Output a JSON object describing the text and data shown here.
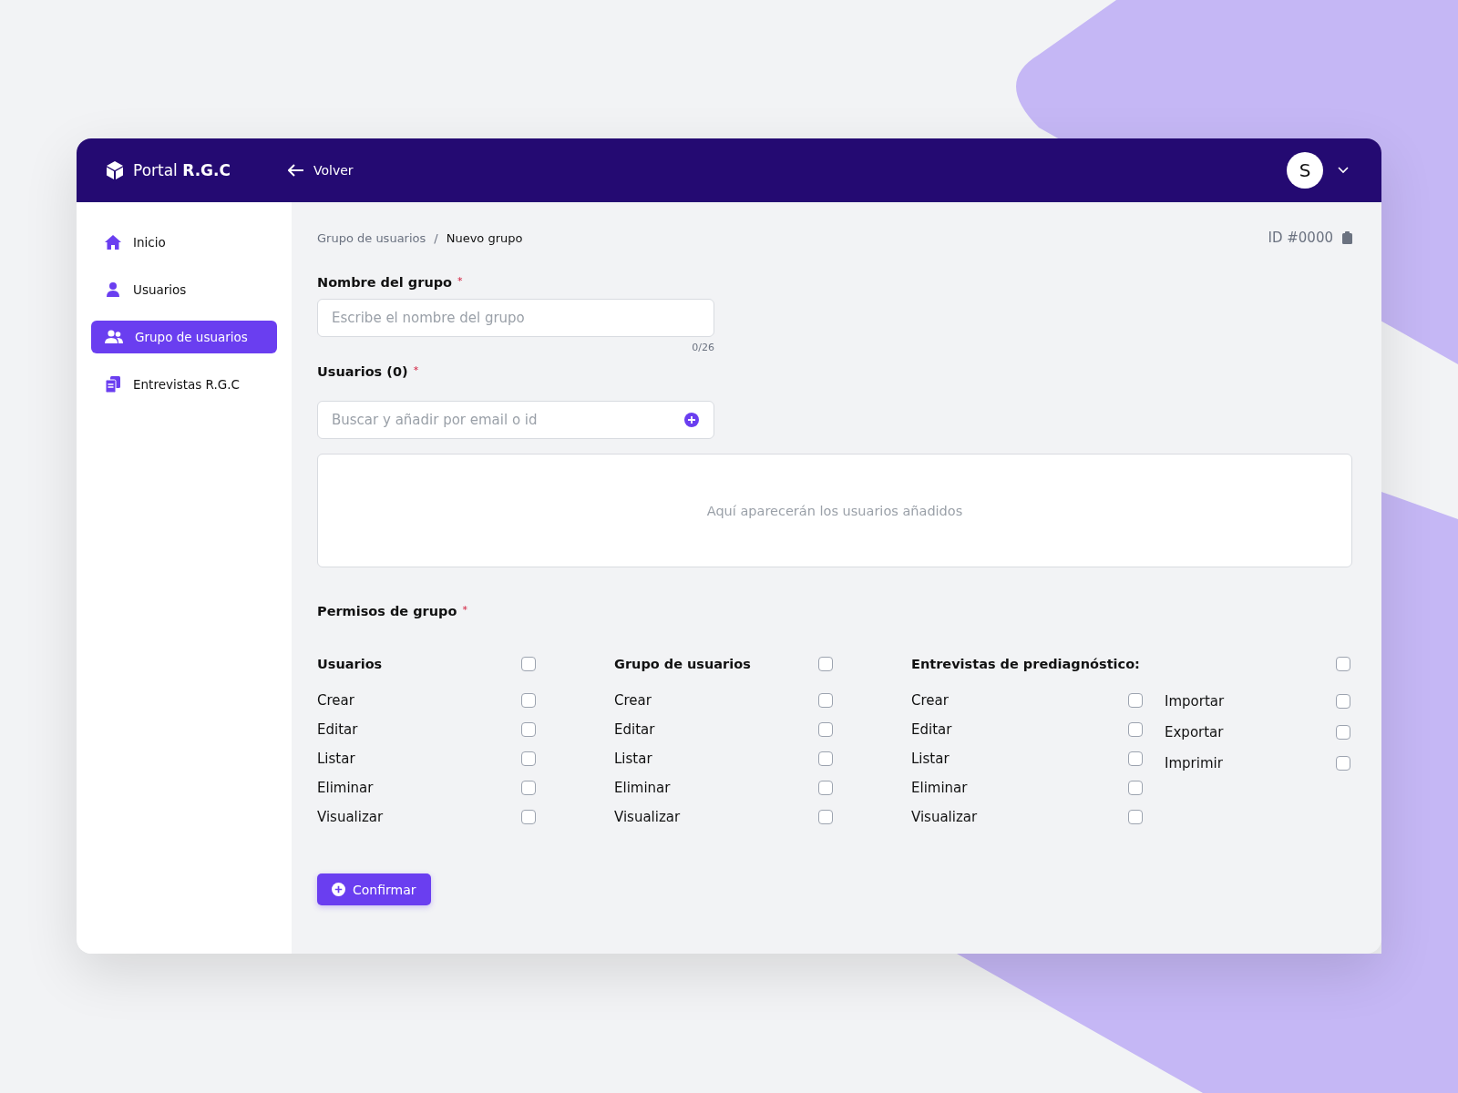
{
  "header": {
    "brand": "Portal",
    "brand_bold": "R.G.C",
    "back": "Volver",
    "avatar": "S"
  },
  "sidebar": {
    "items": [
      {
        "label": "Inicio",
        "kind": "home",
        "selected": false
      },
      {
        "label": "Usuarios",
        "kind": "user",
        "selected": false
      },
      {
        "label": "Grupo de usuarios",
        "kind": "group",
        "selected": true
      },
      {
        "label": "Entrevistas R.G.C",
        "kind": "docs",
        "selected": false
      }
    ]
  },
  "breadcrumb": {
    "parent": "Grupo de usuarios",
    "separator": "/",
    "current": "Nuevo grupo"
  },
  "record_id": "ID #0000",
  "name_field": {
    "label": "Nombre del grupo",
    "required": "*",
    "placeholder": "Escribe el nombre del grupo",
    "counter": "0/26"
  },
  "users_field": {
    "label": "Usuarios (0)",
    "required": "*",
    "placeholder": "Buscar y añadir por email o id",
    "empty_text": "Aquí aparecerán los usuarios añadidos"
  },
  "permissions": {
    "title": "Permisos de grupo",
    "required": "*",
    "groups": [
      {
        "title": "Usuarios",
        "checked": false,
        "items": [
          {
            "label": "Crear",
            "checked": false
          },
          {
            "label": "Editar",
            "checked": false
          },
          {
            "label": "Listar",
            "checked": false
          },
          {
            "label": "Eliminar",
            "checked": false
          },
          {
            "label": "Visualizar",
            "checked": false
          }
        ]
      },
      {
        "title": "Grupo de usuarios",
        "checked": false,
        "items": [
          {
            "label": "Crear",
            "checked": false
          },
          {
            "label": "Editar",
            "checked": false
          },
          {
            "label": "Listar",
            "checked": false
          },
          {
            "label": "Eliminar",
            "checked": false
          },
          {
            "label": "Visualizar",
            "checked": false
          }
        ]
      },
      {
        "title": "Entrevistas de prediagnóstico:",
        "checked": false,
        "items": [
          {
            "label": "Crear",
            "checked": false
          },
          {
            "label": "Editar",
            "checked": false
          },
          {
            "label": "Listar",
            "checked": false
          },
          {
            "label": "Eliminar",
            "checked": false
          },
          {
            "label": "Visualizar",
            "checked": false
          }
        ],
        "extra_items": [
          {
            "label": "Importar",
            "checked": false
          },
          {
            "label": "Exportar",
            "checked": false
          },
          {
            "label": "Imprimir",
            "checked": false
          }
        ]
      }
    ]
  },
  "confirm_button": "Confirmar"
}
